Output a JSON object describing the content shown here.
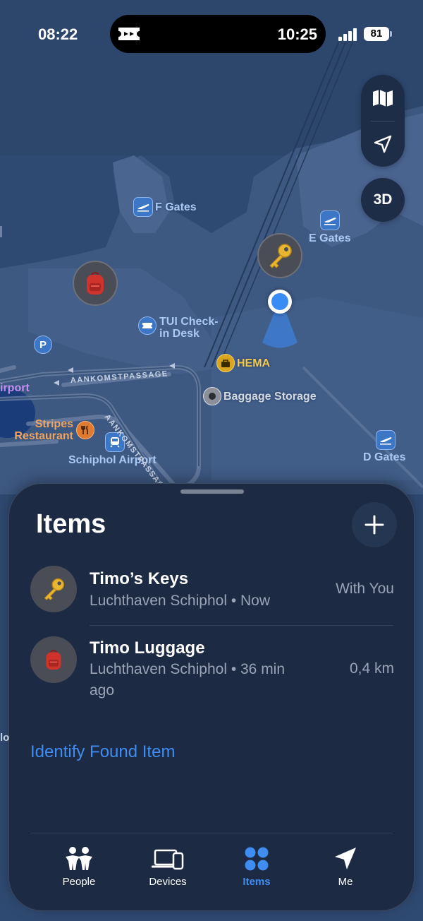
{
  "status": {
    "time": "08:22",
    "island_time": "10:25",
    "battery": "81"
  },
  "map_controls": {
    "three_d": "3D"
  },
  "map": {
    "f_gates": "F Gates",
    "e_gates": "E Gates",
    "d_gates": "D Gates",
    "tui_line1": "TUI Check-",
    "tui_line2": "in Desk",
    "hema": "HEMA",
    "baggage": "Baggage Storage",
    "stripes_line1": "Stripes",
    "stripes_line2": "Restaurant",
    "schiphol": "Schiphol Airport",
    "parking": "P",
    "airport_partial": "irport",
    "road": "AANKOMSTPASSAGE",
    "road2": "AANKOMSTPASSAGE",
    "partial_lo": "lo"
  },
  "sheet": {
    "title": "Items",
    "items": [
      {
        "name": "Timo’s Keys",
        "location": "Luchthaven Schiphol • Now",
        "status": "With You",
        "icon": "key-icon"
      },
      {
        "name": "Timo Luggage",
        "location": "Luchthaven Schiphol • 36 min ago",
        "status": "0,4 km",
        "icon": "backpack-icon"
      }
    ],
    "identify_link": "Identify Found Item"
  },
  "tabs": [
    {
      "label": "People",
      "icon": "people-icon"
    },
    {
      "label": "Devices",
      "icon": "devices-icon"
    },
    {
      "label": "Items",
      "icon": "items-icon",
      "active": true
    },
    {
      "label": "Me",
      "icon": "location-arrow-icon"
    }
  ],
  "colors": {
    "accent": "#3f8df0",
    "sheet": "#1c2a44",
    "map": "#2f4a72"
  }
}
